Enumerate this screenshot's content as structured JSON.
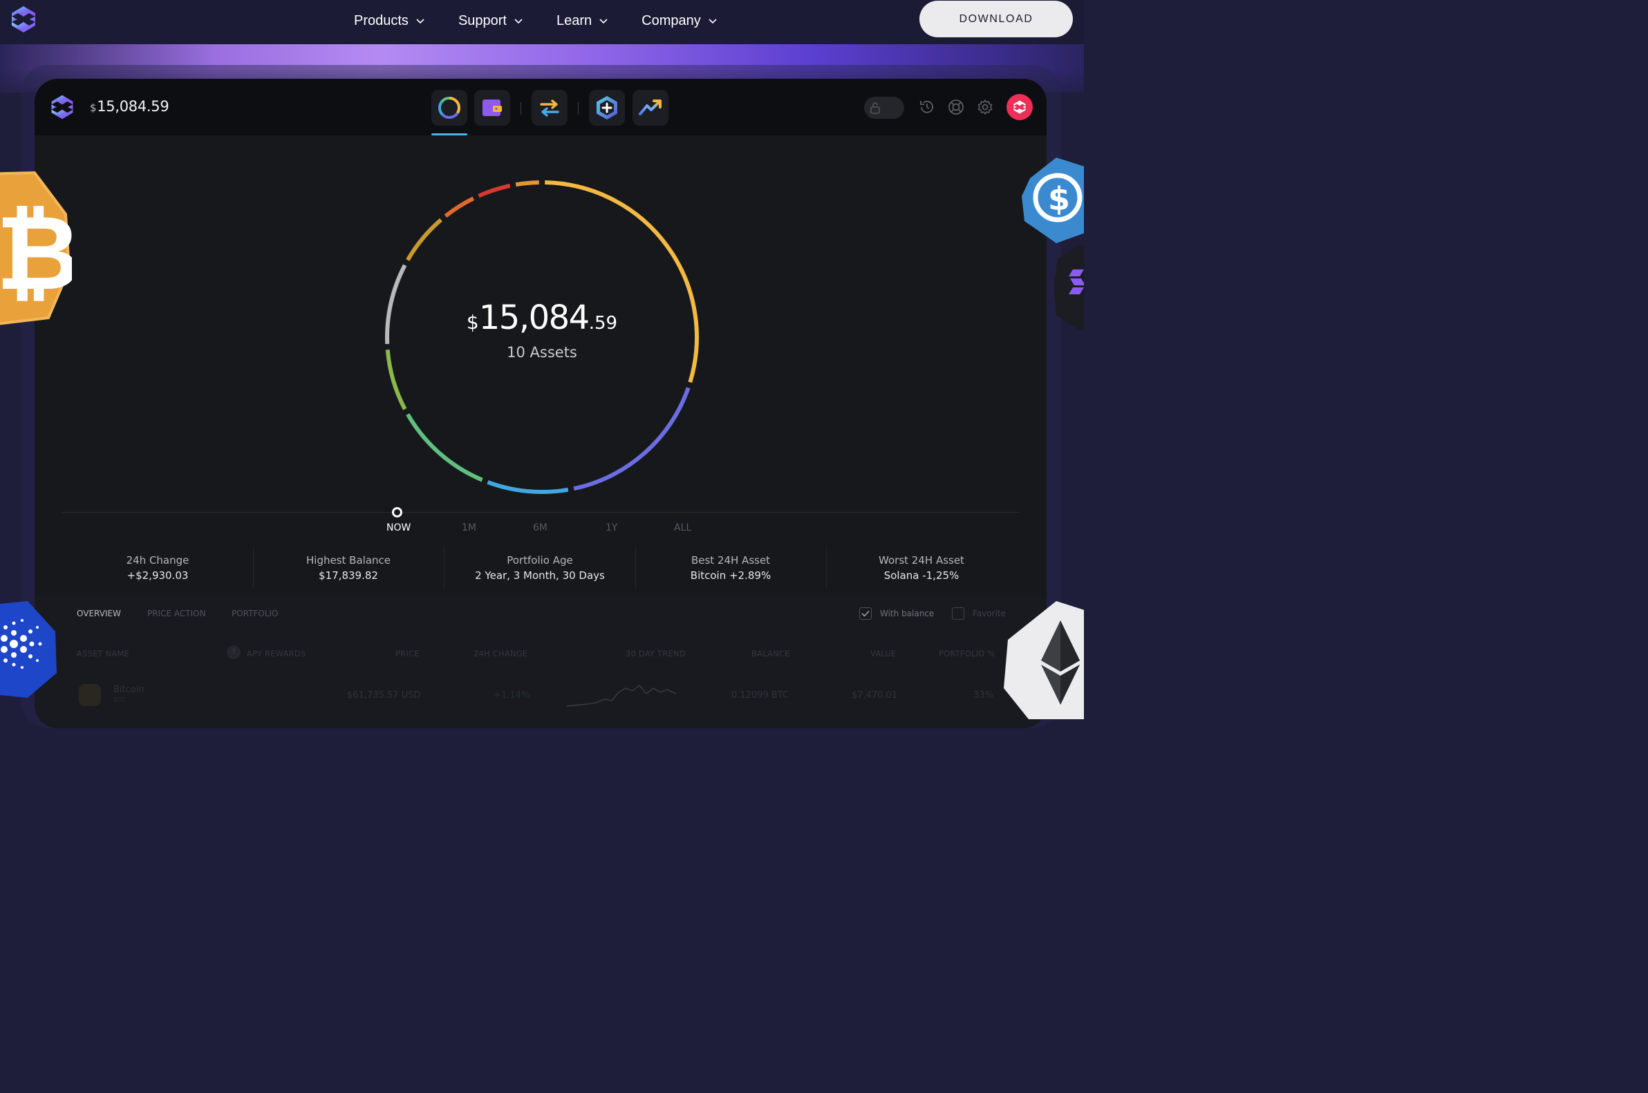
{
  "nav": {
    "links": [
      {
        "label": "Products"
      },
      {
        "label": "Support"
      },
      {
        "label": "Learn"
      },
      {
        "label": "Company"
      }
    ],
    "download_label": "DOWNLOAD"
  },
  "app": {
    "header_balance": {
      "currency": "$",
      "amount": "15,084.59"
    },
    "donut": {
      "currency": "$",
      "whole": "15,084",
      "cents": ".59",
      "asset_count": "10 Assets"
    },
    "timeline": [
      "NOW",
      "1M",
      "6M",
      "1Y",
      "ALL"
    ],
    "stats": [
      {
        "label": "24h Change",
        "value": "+$2,930.03"
      },
      {
        "label": "Highest Balance",
        "value": "$17,839.82"
      },
      {
        "label": "Portfolio Age",
        "value": "2 Year, 3 Month, 30 Days"
      },
      {
        "label": "Best 24H Asset",
        "value": "Bitcoin +2.89%"
      },
      {
        "label": "Worst 24H Asset",
        "value": "Solana -1,25%"
      }
    ],
    "overview_tabs": [
      "OVERVIEW",
      "PRICE ACTION",
      "PORTFOLIO"
    ],
    "filters": {
      "with_balance": "With balance",
      "favorite": "Favorite"
    },
    "columns": [
      "ASSET NAME",
      "APY REWARDS",
      "PRICE",
      "24H CHANGE",
      "30 DAY TREND",
      "BALANCE",
      "VALUE",
      "PORTFOLIO %"
    ],
    "row": {
      "name": "Bitcoin",
      "ticker": "BTC",
      "price": "$61,735.57 USD",
      "change": "+1.14%",
      "balance": "0.12099 BTC",
      "value": "$7,470.01",
      "portfolio": "33%"
    }
  },
  "colors": {
    "accent": "#47b3ef",
    "avatar": "#ee2f58",
    "donut_segments": [
      "#f4b942",
      "#6a6ee0",
      "#3fa7e2",
      "#5fbf7f",
      "#8ab84a",
      "#b9b9b9",
      "#c99a2e",
      "#e26a2c",
      "#d43a2f",
      "#e0963a"
    ]
  }
}
